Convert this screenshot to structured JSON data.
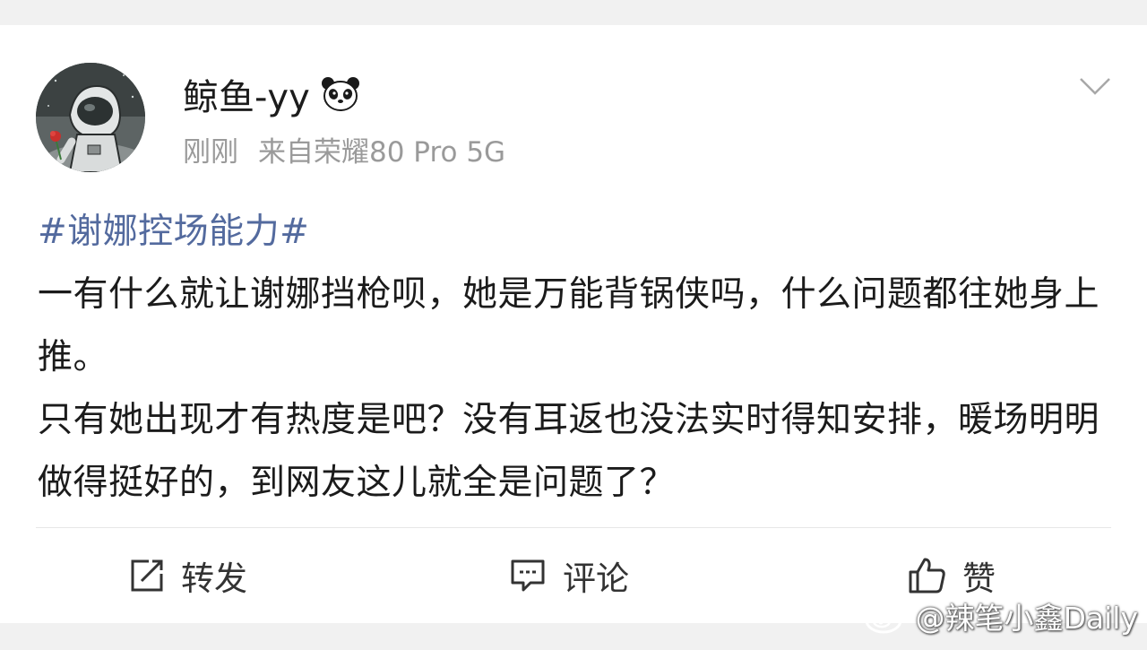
{
  "post": {
    "author": {
      "name": "鲸鱼-yy",
      "avatar_icon": "astronaut-avatar",
      "badge_icon": "panda-icon"
    },
    "meta": {
      "time": "刚刚",
      "source_prefix": "来自",
      "device": "荣耀80 Pro 5G"
    },
    "hashtag": "#谢娜控场能力#",
    "paragraphs": [
      "一有什么就让谢娜挡枪呗，她是万能背锅侠吗，什么问题都往她身上推。",
      "只有她出现才有热度是吧？没有耳返也没法实时得知安排，暖场明明做得挺好的，到网友这儿就全是问题了？"
    ]
  },
  "actions": {
    "repost_label": "转发",
    "comment_label": "评论",
    "like_label": "赞"
  },
  "watermark": {
    "text": "@辣笔小鑫Daily",
    "icon": "weibo-logo-icon"
  },
  "colors": {
    "hashtag": "#536a9e",
    "text": "#1b1b1b",
    "meta": "#9a9a9a",
    "background": "#f1f1f1",
    "card": "#ffffff"
  }
}
